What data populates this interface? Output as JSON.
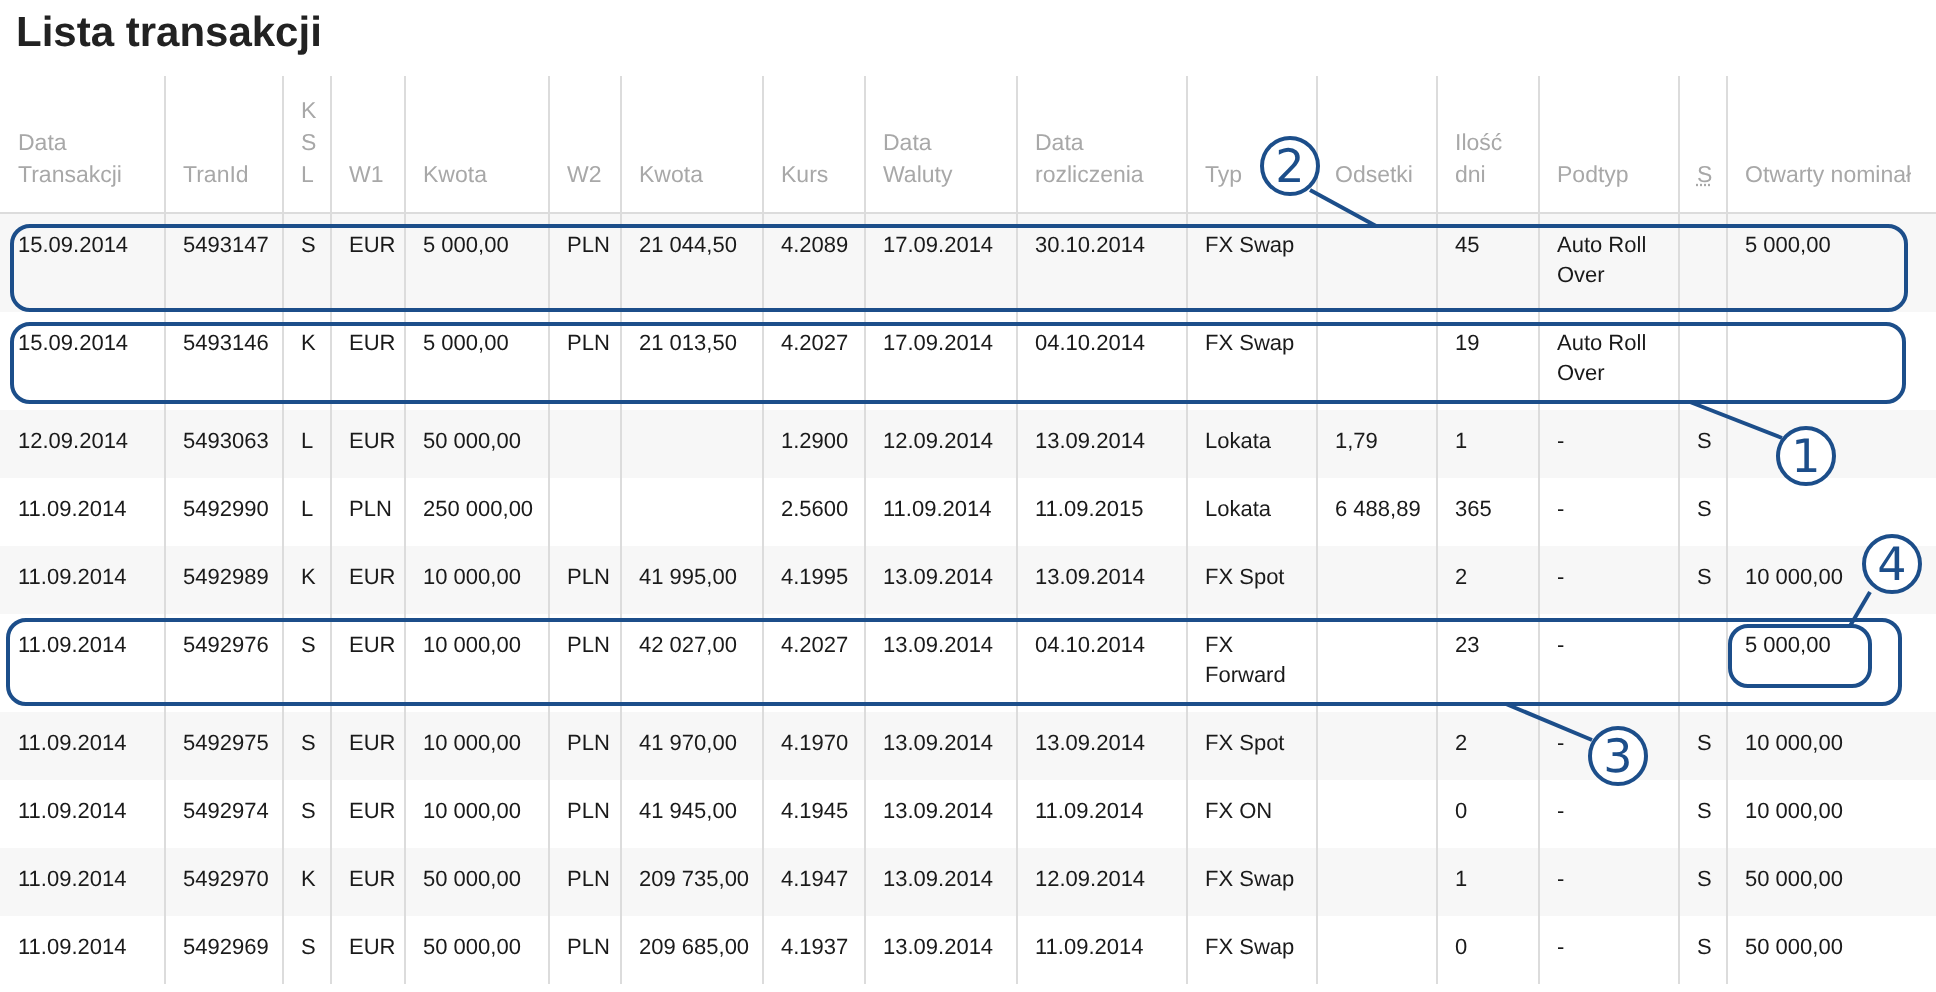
{
  "title": "Lista transakcji",
  "table": {
    "columns": [
      {
        "label": "Data Transakcji",
        "kind": "text"
      },
      {
        "label": "TranId",
        "kind": "text"
      },
      {
        "label": "KSL",
        "kind": "vertical"
      },
      {
        "label": "W1",
        "kind": "text"
      },
      {
        "label": "Kwota",
        "kind": "text"
      },
      {
        "label": "W2",
        "kind": "text"
      },
      {
        "label": "Kwota",
        "kind": "text"
      },
      {
        "label": "Kurs",
        "kind": "text"
      },
      {
        "label": "Data Waluty",
        "kind": "text"
      },
      {
        "label": "Data rozliczenia",
        "kind": "text"
      },
      {
        "label": "Typ",
        "kind": "text"
      },
      {
        "label": "Odsetki",
        "kind": "text"
      },
      {
        "label": "Ilość dni",
        "kind": "text"
      },
      {
        "label": "Podtyp",
        "kind": "text"
      },
      {
        "label": "S",
        "kind": "abbr"
      },
      {
        "label": "Otwarty nominał",
        "kind": "text"
      }
    ],
    "rows": [
      [
        "15.09.2014",
        "5493147",
        "S",
        "EUR",
        "5 000,00",
        "PLN",
        "21 044,50",
        "4.2089",
        "17.09.2014",
        "30.10.2014",
        "FX Swap",
        null,
        "45",
        "Auto Roll Over",
        null,
        "5 000,00"
      ],
      [
        "15.09.2014",
        "5493146",
        "K",
        "EUR",
        "5 000,00",
        "PLN",
        "21 013,50",
        "4.2027",
        "17.09.2014",
        "04.10.2014",
        "FX Swap",
        null,
        "19",
        "Auto Roll Over",
        null,
        null
      ],
      [
        "12.09.2014",
        "5493063",
        "L",
        "EUR",
        "50 000,00",
        null,
        null,
        "1.2900",
        "12.09.2014",
        "13.09.2014",
        "Lokata",
        "1,79",
        "1",
        "-",
        "S",
        null
      ],
      [
        "11.09.2014",
        "5492990",
        "L",
        "PLN",
        "250 000,00",
        null,
        null,
        "2.5600",
        "11.09.2014",
        "11.09.2015",
        "Lokata",
        "6 488,89",
        "365",
        "-",
        "S",
        null
      ],
      [
        "11.09.2014",
        "5492989",
        "K",
        "EUR",
        "10 000,00",
        "PLN",
        "41 995,00",
        "4.1995",
        "13.09.2014",
        "13.09.2014",
        "FX Spot",
        null,
        "2",
        "-",
        "S",
        "10 000,00"
      ],
      [
        "11.09.2014",
        "5492976",
        "S",
        "EUR",
        "10 000,00",
        "PLN",
        "42 027,00",
        "4.2027",
        "13.09.2014",
        "04.10.2014",
        "FX Forward",
        null,
        "23",
        "-",
        null,
        "5 000,00"
      ],
      [
        "11.09.2014",
        "5492975",
        "S",
        "EUR",
        "10 000,00",
        "PLN",
        "41 970,00",
        "4.1970",
        "13.09.2014",
        "13.09.2014",
        "FX Spot",
        null,
        "2",
        "-",
        "S",
        "10 000,00"
      ],
      [
        "11.09.2014",
        "5492974",
        "S",
        "EUR",
        "10 000,00",
        "PLN",
        "41 945,00",
        "4.1945",
        "13.09.2014",
        "11.09.2014",
        "FX ON",
        null,
        "0",
        "-",
        "S",
        "10 000,00"
      ],
      [
        "11.09.2014",
        "5492970",
        "K",
        "EUR",
        "50 000,00",
        "PLN",
        "209 735,00",
        "4.1947",
        "13.09.2014",
        "12.09.2014",
        "FX Swap",
        null,
        "1",
        "-",
        "S",
        "50 000,00"
      ],
      [
        "11.09.2014",
        "5492969",
        "S",
        "EUR",
        "50 000,00",
        "PLN",
        "209 685,00",
        "4.1937",
        "13.09.2014",
        "11.09.2014",
        "FX Swap",
        null,
        "0",
        "-",
        "S",
        "50 000,00"
      ]
    ]
  },
  "callouts": [
    {
      "number": "1"
    },
    {
      "number": "2"
    },
    {
      "number": "3"
    },
    {
      "number": "4"
    }
  ]
}
